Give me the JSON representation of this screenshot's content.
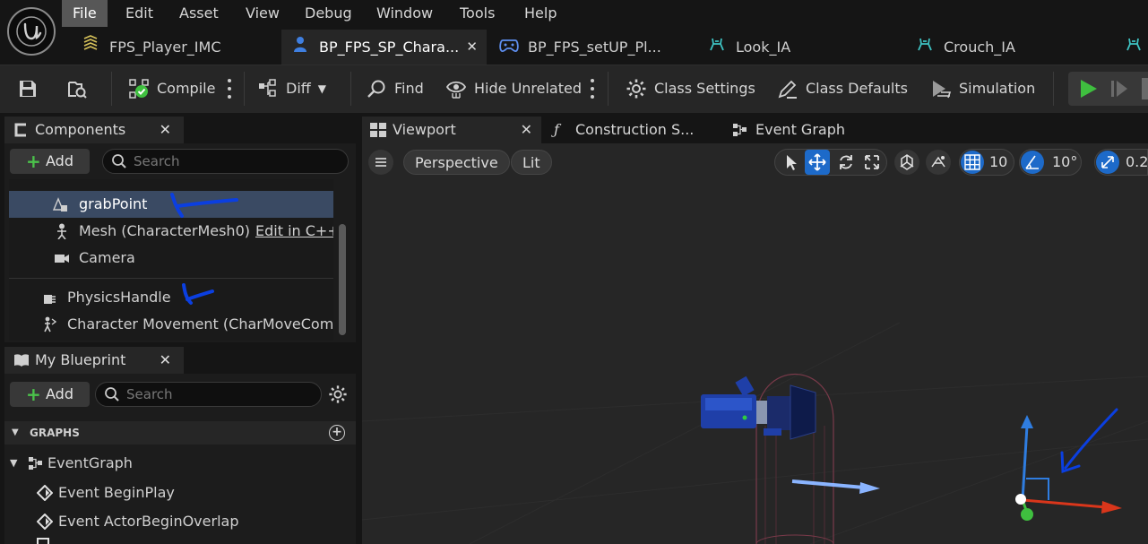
{
  "menu": [
    "File",
    "Edit",
    "Asset",
    "View",
    "Debug",
    "Window",
    "Tools",
    "Help"
  ],
  "doc_tabs": [
    {
      "label": "FPS_Player_IMC"
    },
    {
      "label": "BP_FPS_SP_Chara..."
    },
    {
      "label": "BP_FPS_setUP_Pl..."
    },
    {
      "label": "Look_IA"
    },
    {
      "label": "Crouch_IA"
    }
  ],
  "toolbar": {
    "compile": "Compile",
    "diff": "Diff",
    "find": "Find",
    "hide_unrelated": "Hide Unrelated",
    "class_settings": "Class Settings",
    "class_defaults": "Class Defaults",
    "simulation": "Simulation"
  },
  "components": {
    "title": "Components",
    "add": "Add",
    "search_placeholder": "Search",
    "items": [
      {
        "label": "grabPoint",
        "icon": "scene-component-icon",
        "selected": true
      },
      {
        "label": "Mesh (CharacterMesh0)",
        "icon": "skeleton-icon",
        "extra": "Edit in C++"
      },
      {
        "label": "Camera",
        "icon": "camera-icon"
      },
      {
        "label": "PhysicsHandle",
        "icon": "physics-handle-icon"
      },
      {
        "label": "Character Movement (CharMoveComp",
        "icon": "character-movement-icon"
      }
    ]
  },
  "my_blueprint": {
    "title": "My Blueprint",
    "add": "Add",
    "search_placeholder": "Search",
    "section": "GRAPHS",
    "graph": "EventGraph",
    "events": [
      "Event BeginPlay",
      "Event ActorBeginOverlap"
    ]
  },
  "viewport_tabs": [
    {
      "label": "Viewport"
    },
    {
      "label": "Construction S..."
    },
    {
      "label": "Event Graph"
    }
  ],
  "viewport": {
    "perspective": "Perspective",
    "lit": "Lit",
    "grid_snap": "10",
    "rotation_snap": "10°",
    "scale_snap": "0.2"
  },
  "colors": {
    "accent": "#1d6ac9",
    "selected_row": "#3a4a63",
    "play_green": "#3fbf3f",
    "annotation_blue": "#0b3fe0"
  }
}
